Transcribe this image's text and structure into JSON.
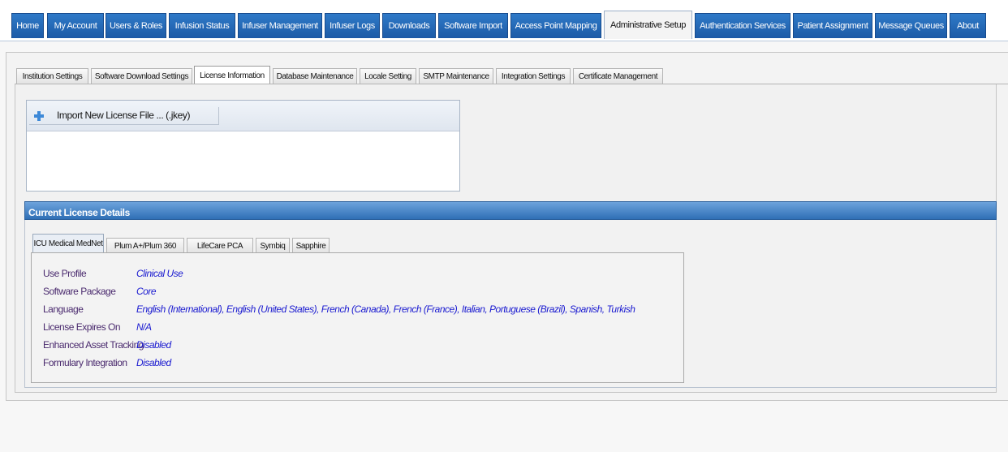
{
  "top_tabs": [
    {
      "label": "Home"
    },
    {
      "label": "My Account"
    },
    {
      "label": "Users & Roles"
    },
    {
      "label": "Infusion Status"
    },
    {
      "label": "Infuser Management"
    },
    {
      "label": "Infuser Logs"
    },
    {
      "label": "Downloads"
    },
    {
      "label": "Software Import"
    },
    {
      "label": "Access Point Mapping"
    },
    {
      "label": "Administrative Setup",
      "active": true
    },
    {
      "label": "Authentication Services"
    },
    {
      "label": "Patient Assignment"
    },
    {
      "label": "Message Queues"
    },
    {
      "label": "About"
    }
  ],
  "sub_tabs": [
    {
      "label": "Institution Settings"
    },
    {
      "label": "Software Download Settings"
    },
    {
      "label": "License Information",
      "active": true
    },
    {
      "label": "Database Maintenance"
    },
    {
      "label": "Locale Setting"
    },
    {
      "label": "SMTP Maintenance"
    },
    {
      "label": "Integration Settings"
    },
    {
      "label": "Certificate Management"
    }
  ],
  "import": {
    "label": "Import New License File  ... (.jkey)",
    "icon": "plus-icon"
  },
  "details": {
    "header": "Current License Details",
    "product_tabs": [
      {
        "label": "ICU Medical MedNet",
        "active": true
      },
      {
        "label": "Plum A+/Plum 360"
      },
      {
        "label": "LifeCare PCA"
      },
      {
        "label": "Symbiq"
      },
      {
        "label": "Sapphire"
      }
    ],
    "rows": [
      {
        "label": "Use Profile",
        "value": "Clinical Use"
      },
      {
        "label": "Software Package",
        "value": "Core"
      },
      {
        "label": "Language",
        "value": "English (International), English (United States), French (Canada), French (France), Italian, Portuguese (Brazil), Spanish, Turkish"
      },
      {
        "label": "License Expires On",
        "value": "N/A"
      },
      {
        "label": "Enhanced Asset Tracking",
        "value": "Disabled"
      },
      {
        "label": "Formulary Integration",
        "value": "Disabled"
      }
    ]
  },
  "colors": {
    "nav_blue": "#1c5aa6",
    "value_blue": "#1a1ad0",
    "label_purple": "#4a2a6e",
    "header_blue": "#2f6fb6"
  }
}
